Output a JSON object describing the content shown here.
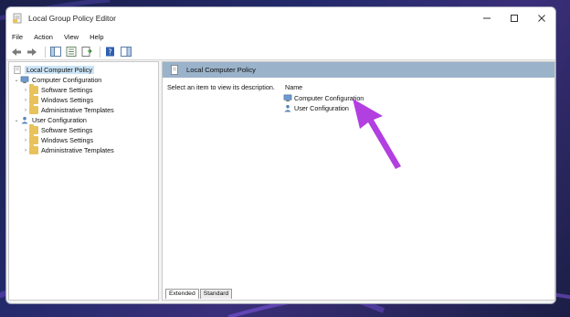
{
  "window": {
    "title": "Local Group Policy Editor",
    "controls": {
      "minimize": "—",
      "maximize": "☐",
      "close": "✕"
    }
  },
  "menu": [
    "File",
    "Action",
    "View",
    "Help"
  ],
  "toolbar_icons": [
    "back-icon",
    "forward-icon",
    "show-hide-tree-icon",
    "properties-icon",
    "export-list-icon",
    "help-icon",
    "show-hide-action-pane-icon"
  ],
  "tree": {
    "root": "Local Computer Policy",
    "computer_configuration": {
      "label": "Computer Configuration",
      "children": [
        "Software Settings",
        "Windows Settings",
        "Administrative Templates"
      ]
    },
    "user_configuration": {
      "label": "User Configuration",
      "children": [
        "Software Settings",
        "Windows Settings",
        "Administrative Templates"
      ]
    }
  },
  "right_pane": {
    "header": "Local Computer Policy",
    "description": "Select an item to view its description.",
    "column_name": "Name",
    "items": [
      "Computer Configuration",
      "User Configuration"
    ]
  },
  "tabs": [
    "Extended",
    "Standard"
  ],
  "colors": {
    "arrow": "#b23fe0",
    "header_bar": "#9ab3cb",
    "selection": "#cce4f7",
    "folder": "#e8c25a"
  }
}
